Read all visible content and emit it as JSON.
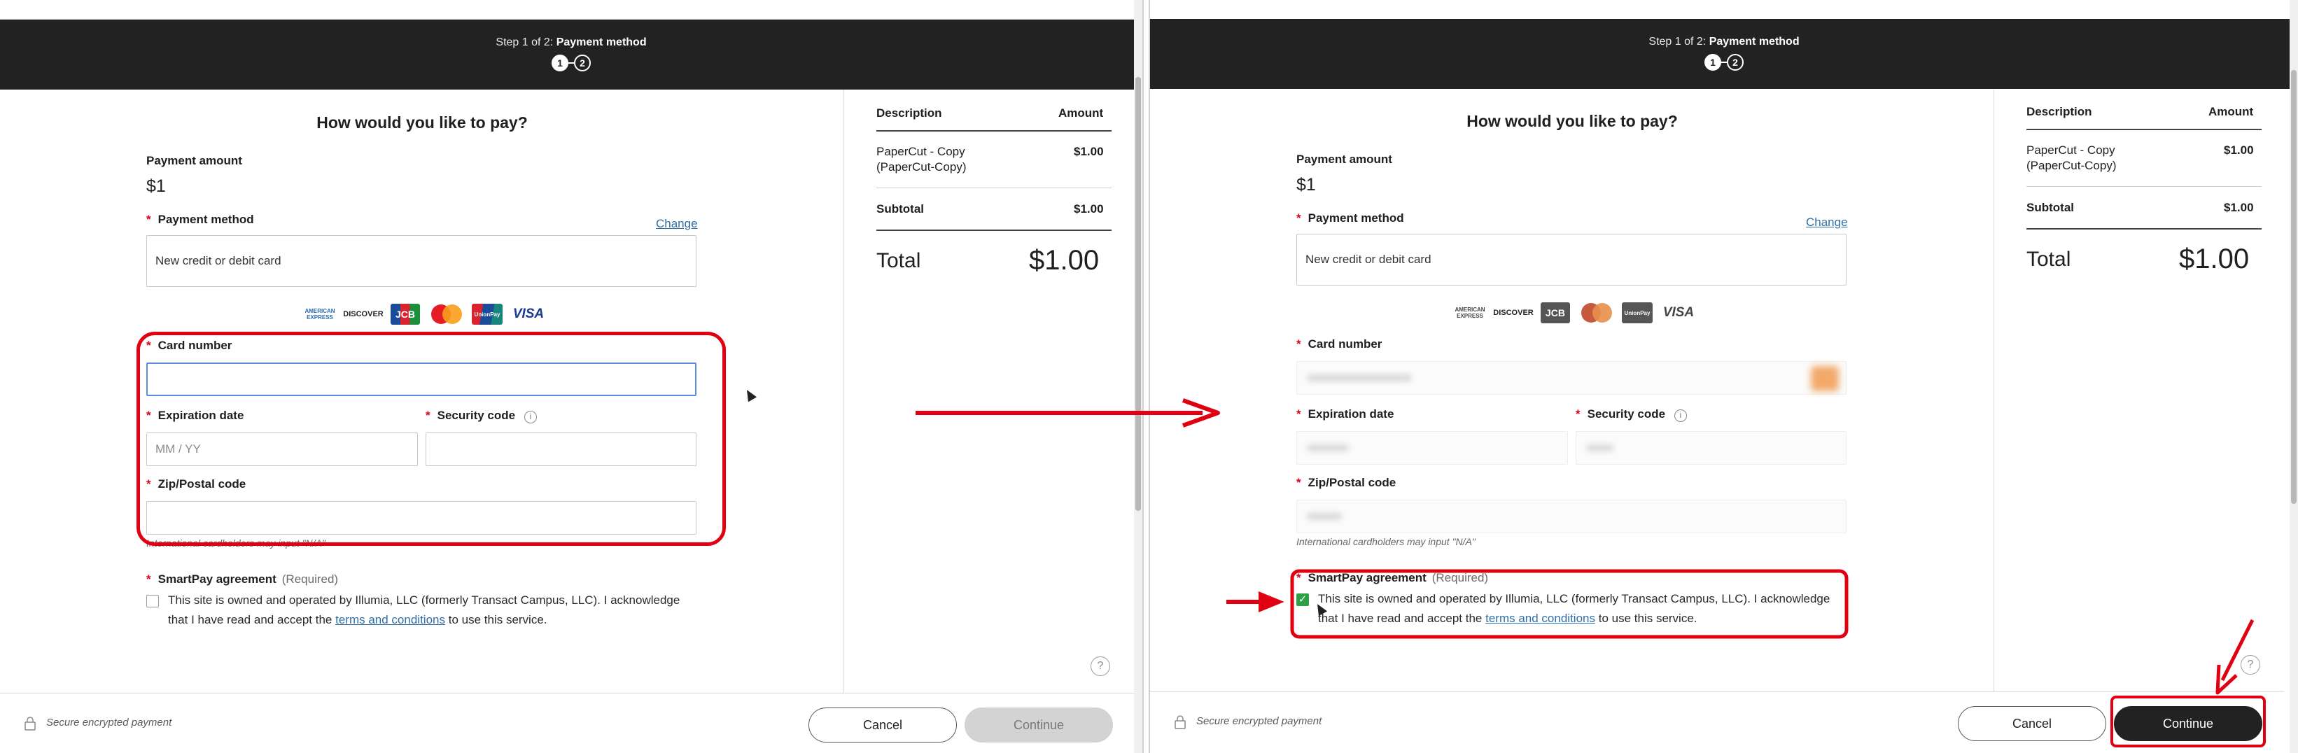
{
  "header": {
    "step_prefix": "Step 1 of 2:",
    "step_title": "Payment method",
    "step_dot_1": "1",
    "step_dot_2": "2"
  },
  "form": {
    "title": "How would you like to pay?",
    "payment_amount_label": "Payment amount",
    "payment_amount_value": "$1",
    "payment_method_label": "Payment method",
    "change_link": "Change",
    "payment_method_value": "New credit or debit card",
    "card_logos": [
      "AMERICAN EXPRESS",
      "DISCOVER",
      "JCB",
      "MasterCard",
      "UnionPay",
      "VISA"
    ],
    "card_number_label": "Card number",
    "expiration_label": "Expiration date",
    "expiration_placeholder": "MM / YY",
    "security_label": "Security code",
    "security_info_icon": "i",
    "zip_label": "Zip/Postal code",
    "intl_hint": "International cardholders may input \"N/A\"",
    "agreement_label": "SmartPay agreement",
    "agreement_required": "(Required)",
    "agreement_text_1": "This site is owned and operated by Illumia, LLC (formerly Transact Campus, LLC). I acknowledge",
    "agreement_text_2_pre": "that I have read and accept the",
    "agreement_link": "terms and conditions",
    "agreement_text_2_post": "to use this service.",
    "left_checkbox_checked": false,
    "right_checkbox_checked": true,
    "help_icon": "?"
  },
  "summary": {
    "col_description": "Description",
    "col_amount": "Amount",
    "item_name_1": "PaperCut - Copy",
    "item_name_2": "(PaperCut-Copy)",
    "item_amount": "$1.00",
    "subtotal_label": "Subtotal",
    "subtotal_value": "$1.00",
    "total_label": "Total",
    "total_value": "$1.00"
  },
  "footer": {
    "secure_text": "Secure encrypted payment",
    "cancel_label": "Cancel",
    "continue_label": "Continue",
    "left_continue_state": "disabled",
    "right_continue_state": "enabled"
  },
  "annotation_colors": {
    "highlight": "#e00012",
    "dark_header": "#222222",
    "link": "#2f6fa8",
    "checkbox_checked": "#2e9e47"
  }
}
